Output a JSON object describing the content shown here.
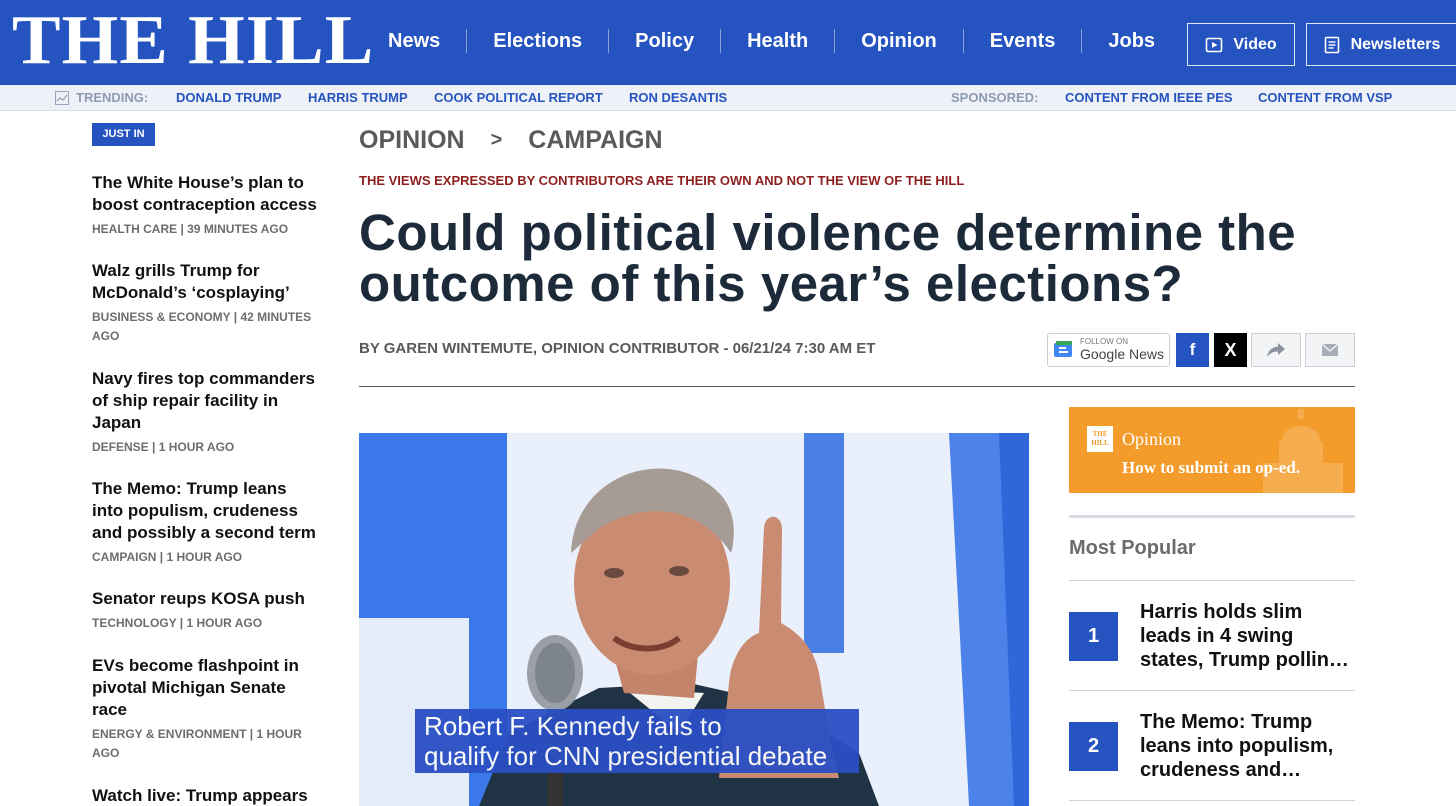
{
  "header": {
    "logo": "THE HILL",
    "nav": [
      "News",
      "Elections",
      "Policy",
      "Health",
      "Opinion",
      "Events",
      "Jobs"
    ],
    "video_label": "Video",
    "newsletters_label": "Newsletters",
    "bg_color": "#2553bf"
  },
  "trending": {
    "label": "TRENDING:",
    "items": [
      "DONALD TRUMP",
      "HARRIS TRUMP",
      "COOK POLITICAL REPORT",
      "RON DESANTIS"
    ],
    "sponsored_label": "SPONSORED:",
    "sponsored": [
      "CONTENT FROM IEEE PES",
      "CONTENT FROM VSP"
    ]
  },
  "rail": {
    "badge": "JUST IN",
    "items": [
      {
        "title": "The White House’s plan to boost contraception access",
        "meta": "HEALTH CARE | 39 MINUTES AGO"
      },
      {
        "title": "Walz grills Trump for McDonald’s ‘cosplaying’",
        "meta": "BUSINESS & ECONOMY | 42 MINUTES AGO"
      },
      {
        "title": "Navy fires top commanders of ship repair facility in Japan",
        "meta": "DEFENSE | 1 HOUR AGO"
      },
      {
        "title": "The Memo: Trump leans into populism, crudeness and possibly a second term",
        "meta": "CAMPAIGN | 1 HOUR AGO"
      },
      {
        "title": "Senator reups KOSA push",
        "meta": "TECHNOLOGY | 1 HOUR AGO"
      },
      {
        "title": "EVs become flashpoint in pivotal Michigan Senate race",
        "meta": "ENERGY & ENVIRONMENT | 1 HOUR AGO"
      },
      {
        "title": "Watch live: Trump appears",
        "meta": ""
      }
    ]
  },
  "article": {
    "crumb_section": "OPINION",
    "crumb_sep": ">",
    "crumb_sub": "CAMPAIGN",
    "disclaimer": "THE VIEWS EXPRESSED BY CONTRIBUTORS ARE THEIR OWN AND NOT THE VIEW OF THE HILL",
    "headline": "Could political violence determine the outcome of this year’s elections?",
    "byline": "BY GAREN WINTEMUTE, OPINION CONTRIBUTOR - 06/21/24 7:30 AM ET",
    "caption_line1": "Robert F. Kennedy fails to",
    "caption_line2": "qualify for CNN presidential debate"
  },
  "share": {
    "gnews_follow": "FOLLOW ON",
    "gnews_name": "Google News",
    "facebook": "f",
    "x": "X"
  },
  "promo": {
    "badge": "THE HILL",
    "title": "Opinion",
    "cta": "How to submit an op-ed."
  },
  "most_popular": {
    "title": "Most Popular",
    "items": [
      {
        "rank": "1",
        "title": "Harris holds slim leads in 4 swing states, Trump pollin…"
      },
      {
        "rank": "2",
        "title": "The Memo: Trump leans into populism, crudeness and…"
      }
    ]
  }
}
